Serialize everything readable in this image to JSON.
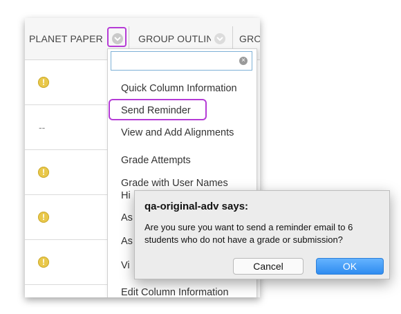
{
  "header": {
    "col1": "PLANET PAPER",
    "col2": "GROUP OUTLIN",
    "col3": "GRO"
  },
  "rows": [
    {
      "type": "warning",
      "symbol": "!"
    },
    {
      "type": "dash",
      "text": "--"
    },
    {
      "type": "warning",
      "symbol": "!"
    },
    {
      "type": "warning",
      "symbol": "!"
    },
    {
      "type": "warning",
      "symbol": "!"
    },
    {
      "type": "dash",
      "text": "--"
    }
  ],
  "menu": {
    "search_value": "",
    "clear_symbol": "×",
    "items": [
      "Quick Column Information",
      "Send Reminder",
      "View and Add Alignments",
      "Grade Attempts",
      "Grade with User Names",
      "Hi",
      "As",
      "As",
      "Vi",
      "Edit Column Information"
    ]
  },
  "dialog": {
    "title": "qa-original-adv says:",
    "message": "Are you sure you want to send a reminder email to 6 students who do not have a grade or submission?",
    "cancel_label": "Cancel",
    "ok_label": "OK"
  },
  "colors": {
    "highlight": "#b53bd6",
    "warning": "#e9c84a",
    "ok_button": "#2f8cf0"
  }
}
